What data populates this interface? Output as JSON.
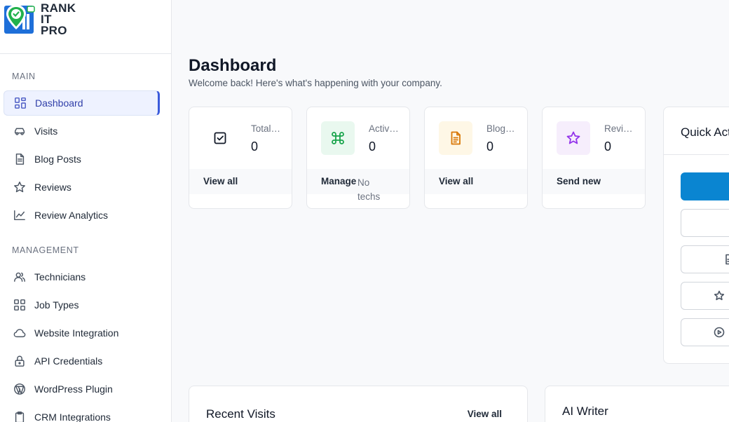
{
  "brand": {
    "line1": "RANK",
    "line2": "IT",
    "line3": "PRO",
    "colors": {
      "blue": "#1e6fd9",
      "green": "#22b14c"
    }
  },
  "sidebar": {
    "sections": [
      {
        "label": "MAIN"
      },
      {
        "label": "MANAGEMENT"
      }
    ],
    "items": [
      {
        "label": "Dashboard",
        "icon": "grid-icon",
        "active": true
      },
      {
        "label": "Visits",
        "icon": "car-icon"
      },
      {
        "label": "Blog Posts",
        "icon": "document-icon"
      },
      {
        "label": "Reviews",
        "icon": "star-icon"
      },
      {
        "label": "Review Analytics",
        "icon": "line-chart-icon"
      },
      {
        "label": "Technicians",
        "icon": "user-icon"
      },
      {
        "label": "Job Types",
        "icon": "grid-icon"
      },
      {
        "label": "Website Integration",
        "icon": "cloud-icon"
      },
      {
        "label": "API Credentials",
        "icon": "lock-icon"
      },
      {
        "label": "WordPress Plugin",
        "icon": "globe-icon"
      },
      {
        "label": "CRM Integrations",
        "icon": "clipboard-icon"
      }
    ]
  },
  "header": {
    "title": "Dashboard",
    "subtitle": "Welcome back! Here's what's happening with your company."
  },
  "stats": [
    {
      "label": "Total Visits",
      "value": "0",
      "link": "View all",
      "note": "",
      "icon": "check-square-icon",
      "icon_bg": "#ffffff",
      "icon_color": "#111827"
    },
    {
      "label": "Active Technicians",
      "value": "0",
      "link": "Manage",
      "note": "No techs",
      "icon": "command-icon",
      "icon_bg": "#e9f8ef",
      "icon_color": "#16a34a"
    },
    {
      "label": "Blog Posts",
      "value": "0",
      "link": "View all",
      "note": "",
      "icon": "file-text-icon",
      "icon_bg": "#fef7e6",
      "icon_color": "#d97706"
    },
    {
      "label": "Reviews",
      "value": "0",
      "link": "Send new",
      "note": "",
      "icon": "star-icon",
      "icon_bg": "#f6eefc",
      "icon_color": "#9333ea"
    }
  ],
  "quick_actions": {
    "title": "Quick Actions",
    "accent": "#0a85d1"
  },
  "recent_visits": {
    "title": "Recent Visits",
    "link": "View all"
  },
  "ai_writer": {
    "title": "AI Writer"
  }
}
